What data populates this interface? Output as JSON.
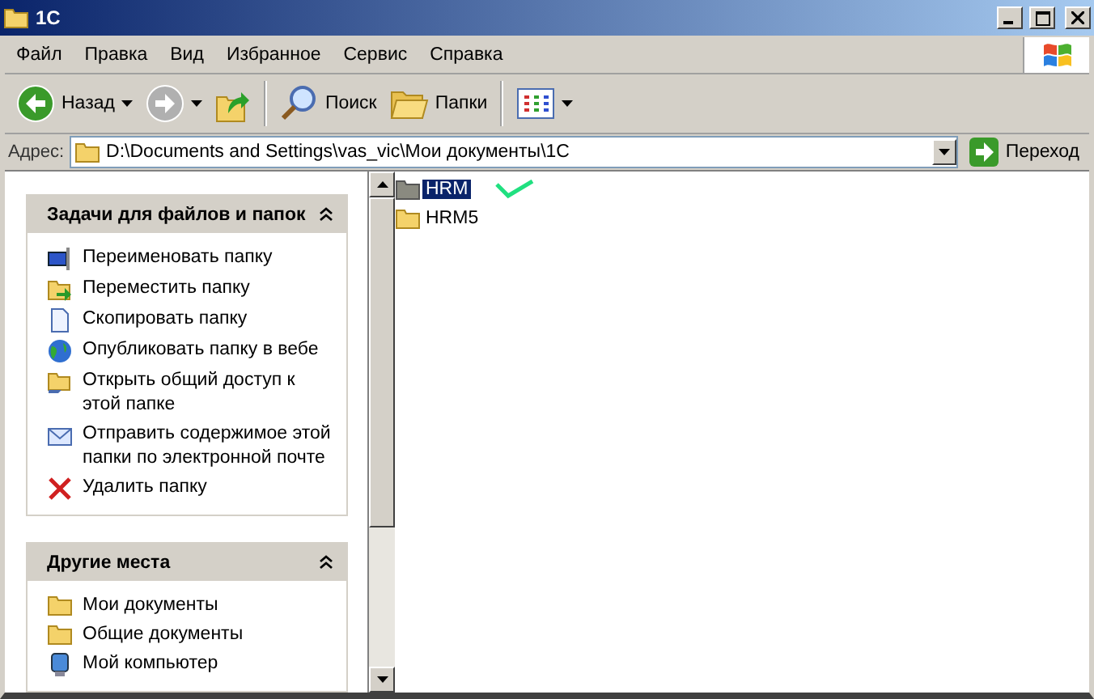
{
  "window": {
    "title": "1C"
  },
  "menu": [
    "Файл",
    "Правка",
    "Вид",
    "Избранное",
    "Сервис",
    "Справка"
  ],
  "toolbar": [
    {
      "kind": "back",
      "label": "Назад",
      "disabled": false
    },
    {
      "kind": "forward",
      "disabled": true
    },
    {
      "kind": "up"
    },
    {
      "kind": "search",
      "label": "Поиск"
    },
    {
      "kind": "folders",
      "label": "Папки"
    },
    {
      "kind": "views"
    }
  ],
  "address": {
    "label": "Адрес:",
    "value": "D:\\Documents and Settings\\vas_vic\\Мои документы\\1C",
    "go": "Переход"
  },
  "panels": [
    {
      "title": "Задачи для файлов и папок",
      "expanded": true,
      "items": [
        "Переименовать папку",
        "Переместить папку",
        "Скопировать папку",
        "Опубликовать папку в вебе",
        "Открыть общий доступ к этой папке",
        "Отправить содержимое этой папки по электронной почте",
        "Удалить папку"
      ]
    },
    {
      "title": "Другие места",
      "expanded": true,
      "items": [
        "Мои документы",
        "Общие документы",
        "Мой компьютер"
      ]
    }
  ],
  "files": [
    {
      "name": "HRM",
      "selected": true
    },
    {
      "name": "HRM5",
      "selected": false
    }
  ]
}
